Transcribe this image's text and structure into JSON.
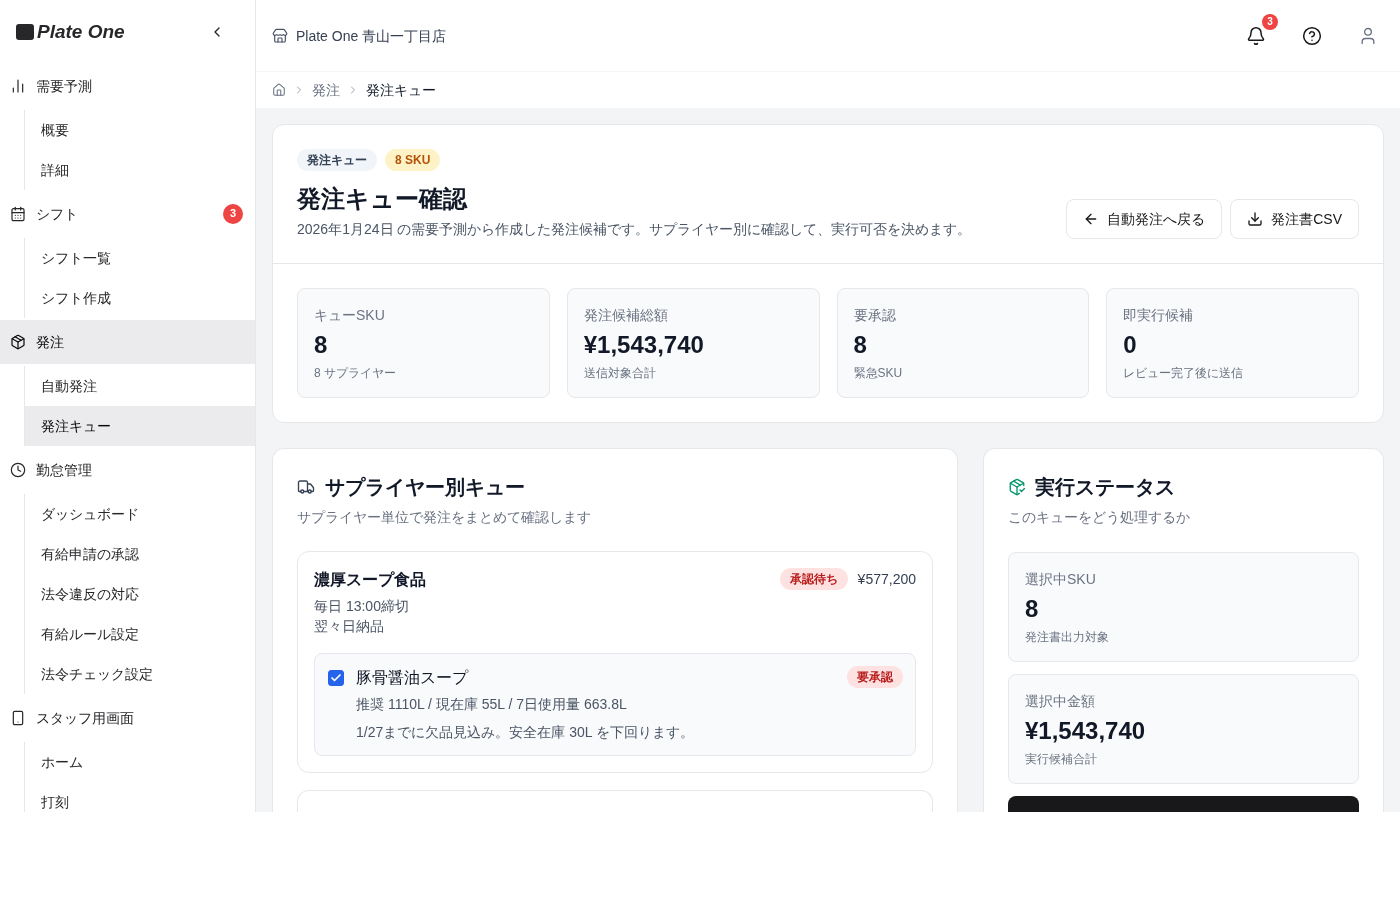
{
  "sidebar": {
    "logo": "Plate One",
    "sections": [
      {
        "label": "需要予測",
        "selected": false,
        "children": [
          {
            "label": "概要",
            "selected": false
          },
          {
            "label": "詳細",
            "selected": false
          }
        ]
      },
      {
        "label": "シフト",
        "selected": false,
        "badge": "3",
        "children": [
          {
            "label": "シフト一覧",
            "selected": false
          },
          {
            "label": "シフト作成",
            "selected": false
          }
        ]
      },
      {
        "label": "発注",
        "selected": true,
        "children": [
          {
            "label": "自動発注",
            "selected": false
          },
          {
            "label": "発注キュー",
            "selected": true
          }
        ]
      },
      {
        "label": "勤怠管理",
        "selected": false,
        "children": [
          {
            "label": "ダッシュボード",
            "selected": false
          },
          {
            "label": "有給申請の承認",
            "selected": false
          },
          {
            "label": "法令違反の対応",
            "selected": false
          },
          {
            "label": "有給ルール設定",
            "selected": false
          },
          {
            "label": "法令チェック設定",
            "selected": false
          }
        ]
      },
      {
        "label": "スタッフ用画面",
        "selected": false,
        "children": [
          {
            "label": "ホーム",
            "selected": false
          },
          {
            "label": "打刻",
            "selected": false
          }
        ]
      }
    ]
  },
  "topbar": {
    "store": "Plate One 青山一丁目店",
    "notification_count": "3"
  },
  "breadcrumb": [
    {
      "label": "発注",
      "current": false
    },
    {
      "label": "発注キュー",
      "current": true
    }
  ],
  "summary": {
    "chips": [
      {
        "text": "発注キュー",
        "kind": "neutral"
      },
      {
        "text": "8 SKU",
        "kind": "warning"
      }
    ],
    "title": "発注キュー確認",
    "description": "2026年1月24日 の需要予測から作成した発注候補です。サプライヤー別に確認して、実行可否を決めます。",
    "buttons": [
      {
        "label": "自動発注へ戻る",
        "kind": "back"
      },
      {
        "label": "発注書CSV",
        "kind": "download"
      }
    ],
    "stats": [
      {
        "label": "キューSKU",
        "value": "8",
        "note": "8 サプライヤー"
      },
      {
        "label": "発注候補総額",
        "value": "¥1,543,740",
        "note": "送信対象合計"
      },
      {
        "label": "要承認",
        "value": "8",
        "note": "緊急SKU"
      },
      {
        "label": "即実行候補",
        "value": "0",
        "note": "レビュー完了後に送信"
      }
    ]
  },
  "supplier_queue": {
    "title": "サプライヤー別キュー",
    "subtitle": "サプライヤー単位で発注をまとめて確認します",
    "suppliers": [
      {
        "name": "濃厚スープ食品",
        "status": "承認待ち",
        "amount": "¥577,200",
        "cutoff": "毎日 13:00締切",
        "delivery": "翌々日納品",
        "items": [
          {
            "name": "豚骨醤油スープ",
            "checked": true,
            "badge": "要承認",
            "detail": "推奨 1110L / 現在庫 55L / 7日使用量 663.8L",
            "note": "1/27までに欠品見込み。安全在庫 30L を下回ります。"
          }
        ]
      }
    ]
  },
  "execution": {
    "title": "実行ステータス",
    "subtitle": "このキューをどう処理するか",
    "stats": [
      {
        "label": "選択中SKU",
        "value": "8",
        "note": "発注書出力対象"
      },
      {
        "label": "選択中金額",
        "value": "¥1,543,740",
        "note": "実行候補合計"
      }
    ]
  }
}
